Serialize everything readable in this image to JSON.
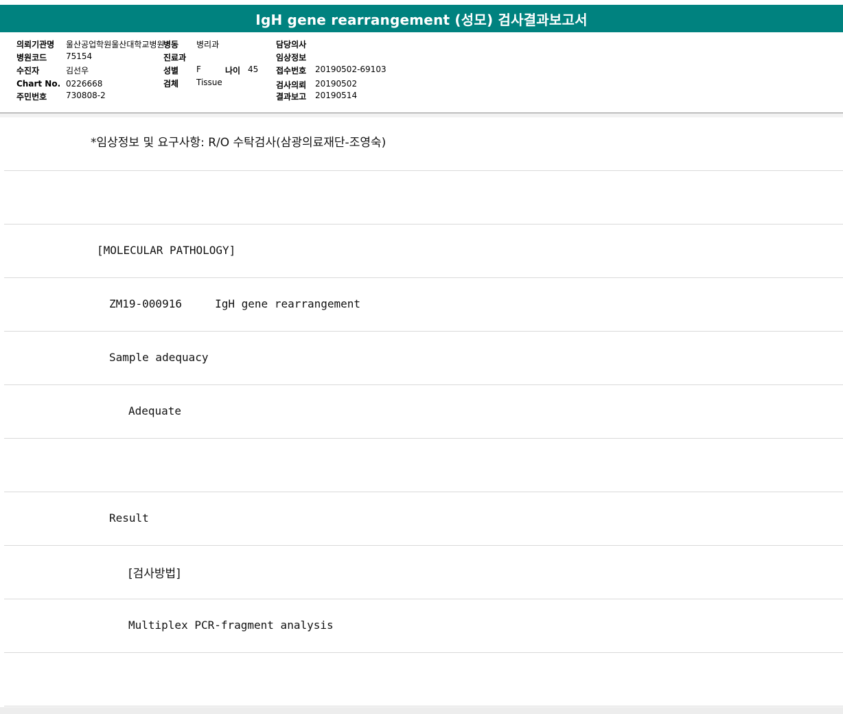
{
  "title": "IgH gene rearrangement (성모) 검사결과보고서",
  "header": {
    "institution_label": "의뢰기관명",
    "institution_value": "울산공업학원울산대학교병원",
    "ward_label": "병동",
    "ward_value": "병리과",
    "doctor_label": "담당의사",
    "doctor_value": "",
    "hospital_code_label": "병원코드",
    "hospital_code_value": "75154",
    "dept_label": "진료과",
    "dept_value": "",
    "clinical_info_label": "임상정보",
    "clinical_info_value": "",
    "patient_label": "수진자",
    "patient_value": "김선우",
    "sex_label": "성별",
    "sex_value": "F",
    "age_label": "나이",
    "age_value": "45",
    "reception_label": "접수번호",
    "reception_value": "20190502-69103",
    "chart_label": "Chart No.",
    "chart_value": "0226668",
    "specimen_label": "검체",
    "specimen_value": "Tissue",
    "request_label": "검사의뢰",
    "request_value": "20190502",
    "rrn_label": "주민번호",
    "rrn_value": "730808-2",
    "report_label": "결과보고",
    "report_value": "20190514"
  },
  "report_lines": [
    "*임상정보 및 요구사항: R/O 수탁검사(삼광의료재단-조영숙)",
    "",
    "[MOLECULAR PATHOLOGY]",
    "ZM19-000916     IgH gene rearrangement",
    "Sample adequacy",
    "Adequate",
    "",
    "Result",
    "[검사방법]",
    "Multiplex PCR-fragment analysis",
    ""
  ],
  "colors": {
    "title_bg": "#00827f",
    "title_text": "#ffffff",
    "row_divider": "#d9d9d9"
  }
}
